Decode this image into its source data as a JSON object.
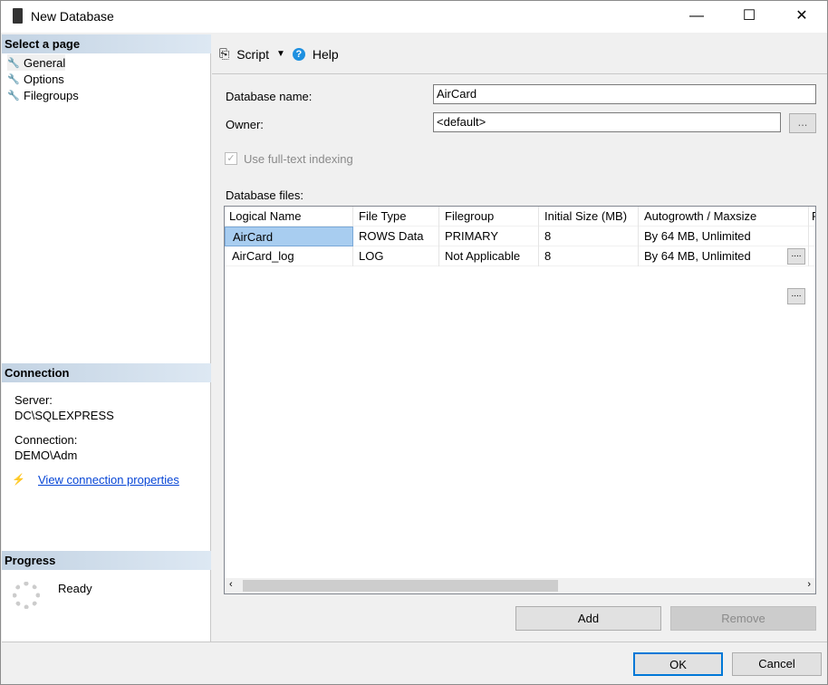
{
  "window": {
    "title": "New Database",
    "minimize": "—",
    "maximize": "☐",
    "close": "✕"
  },
  "sidebar": {
    "select_header": "Select a page",
    "pages": [
      {
        "label": "General"
      },
      {
        "label": "Options"
      },
      {
        "label": "Filegroups"
      }
    ],
    "connection_header": "Connection",
    "server_label": "Server:",
    "server_value": "DC\\SQLEXPRESS",
    "connection_label": "Connection:",
    "connection_value": "DEMO\\Adm",
    "view_link": "View connection properties",
    "progress_header": "Progress",
    "progress_status": "Ready"
  },
  "toolbar": {
    "script": "Script",
    "help": "Help"
  },
  "form": {
    "db_name_label": "Database name:",
    "db_name_value": "AirCard",
    "owner_label": "Owner:",
    "owner_value": "<default>",
    "browse": "...",
    "fulltext_label": "Use full-text indexing",
    "fulltext_checked": true,
    "files_label": "Database files:"
  },
  "table": {
    "headers": [
      "Logical Name",
      "File Type",
      "Filegroup",
      "Initial Size (MB)",
      "Autogrowth / Maxsize",
      "Path"
    ],
    "rows": [
      [
        "AirCard",
        "ROWS Data",
        "PRIMARY",
        "8",
        "By 64 MB, Unlimited"
      ],
      [
        "AirCard_log",
        "LOG",
        "Not Applicable",
        "8",
        "By 64 MB, Unlimited"
      ]
    ],
    "cell_button": "...."
  },
  "buttons": {
    "add": "Add",
    "remove": "Remove",
    "ok": "OK",
    "cancel": "Cancel"
  }
}
